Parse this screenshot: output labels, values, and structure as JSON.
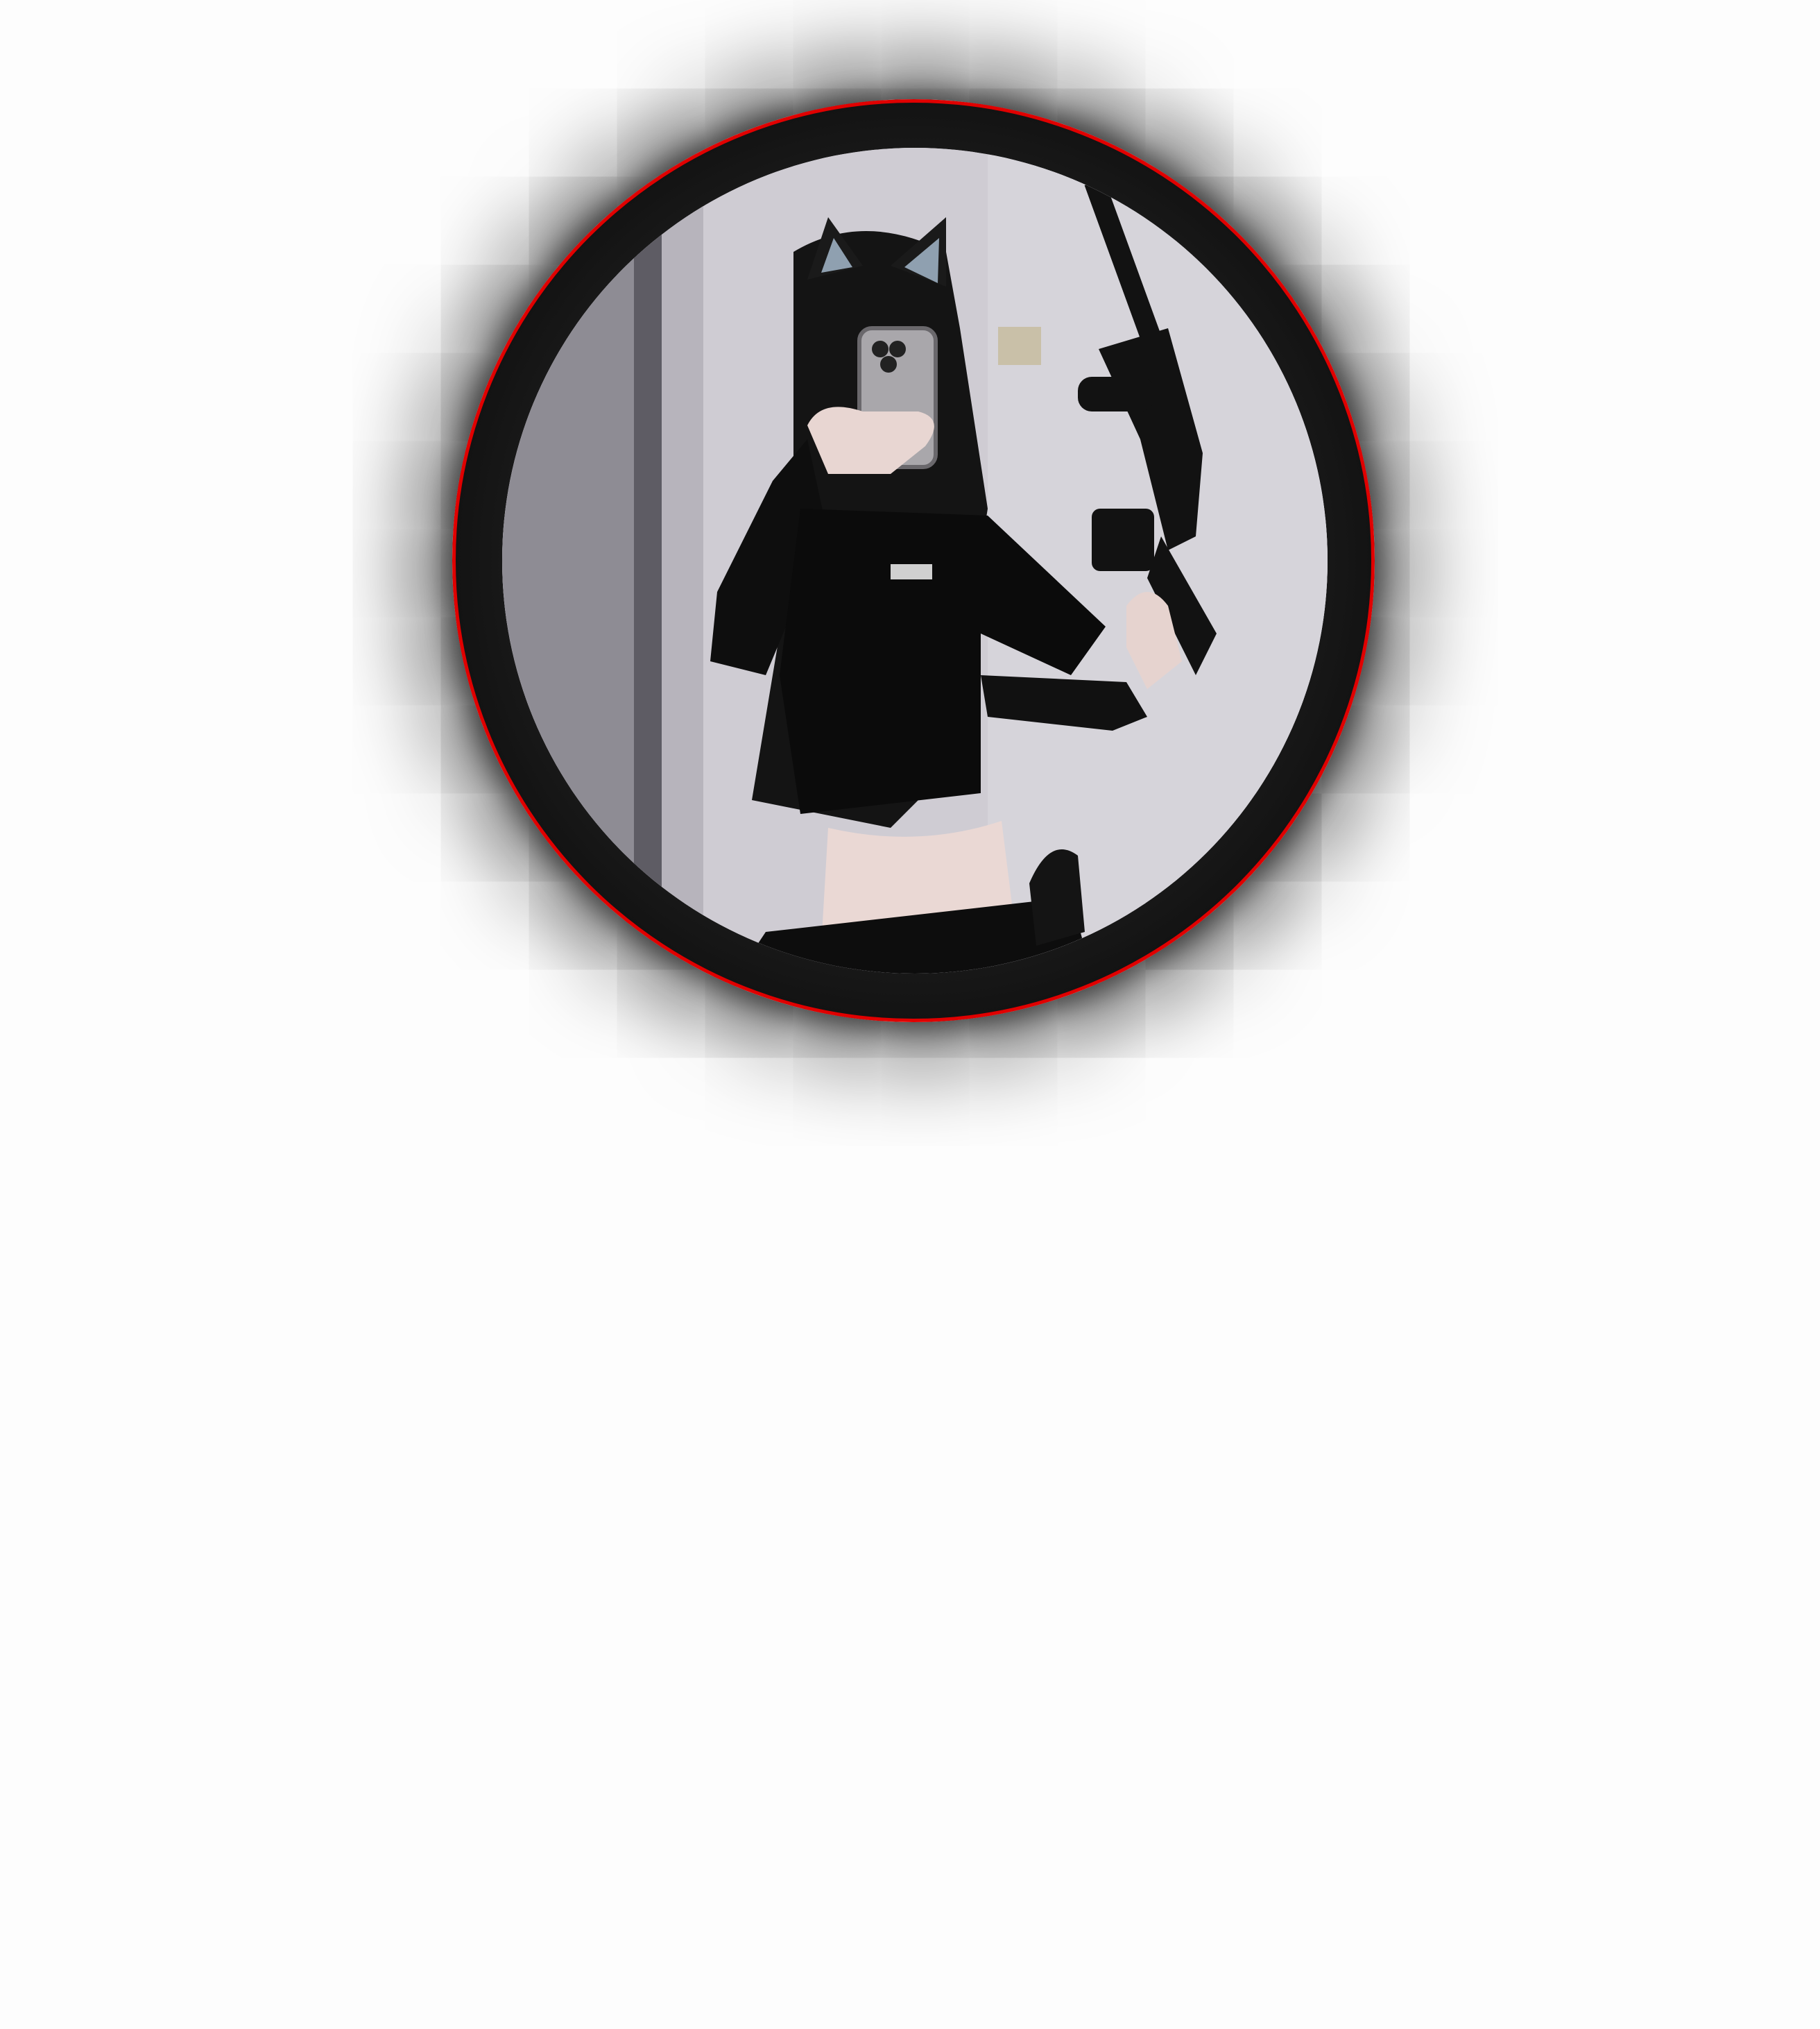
{
  "profile": {
    "avatar": {
      "ring_color": "#e00000",
      "shadow_color": "#000000",
      "icon": "avatar-photo"
    }
  },
  "page": {
    "background": "#fdfdfd"
  }
}
